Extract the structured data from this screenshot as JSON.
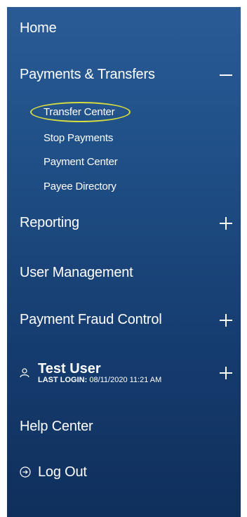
{
  "nav": {
    "home": "Home",
    "payments": {
      "label": "Payments & Transfers",
      "expanded": true,
      "children": [
        "Transfer Center",
        "Stop Payments",
        "Payment Center",
        "Payee Directory"
      ]
    },
    "reporting": "Reporting",
    "user_management": "User Management",
    "payment_fraud_control": "Payment Fraud Control",
    "user": {
      "name": "Test User",
      "last_login_label": "LAST LOGIN:",
      "last_login_value": "08/11/2020 11:21 AM"
    },
    "help_center": "Help Center",
    "logout": "Log Out"
  },
  "colors": {
    "nav_top": "#2a5b96",
    "nav_bottom": "#0f2f5c",
    "highlight": "#d8dd3f",
    "text": "#ffffff"
  },
  "icons": {
    "collapse": "minus-icon",
    "expand": "plus-icon",
    "user": "user-icon",
    "logout": "logout-icon"
  }
}
